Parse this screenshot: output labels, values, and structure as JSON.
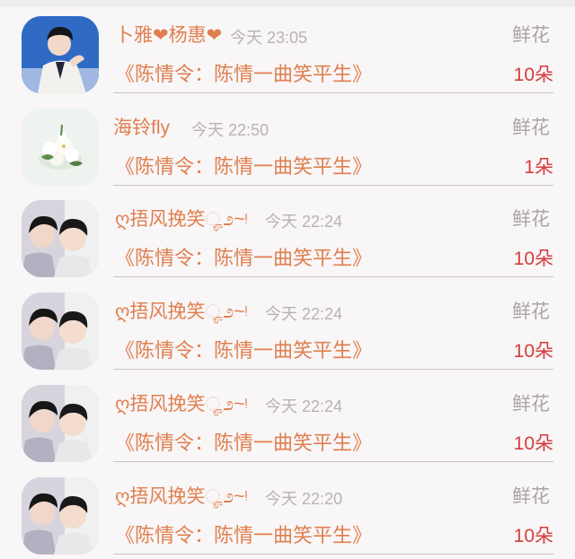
{
  "items": [
    {
      "name": "卜雅❤杨惠❤",
      "time": "今天 23:05",
      "gift": "鲜花",
      "title": "《陈情令：陈情一曲笑平生》",
      "count": "10朵",
      "avatar": "man-white-suit-photo"
    },
    {
      "name": "海铃fly",
      "time": "今天 22:50",
      "gift": "鲜花",
      "title": "《陈情令：陈情一曲笑平生》",
      "count": "1朵",
      "avatar": "white-flower-bouquet-photo"
    },
    {
      "name": "ღ捂风挽笑ೄ೨~ᵎ",
      "time": "今天 22:24",
      "gift": "鲜花",
      "title": "《陈情令：陈情一曲笑平生》",
      "count": "10朵",
      "avatar": "two-men-photo"
    },
    {
      "name": "ღ捂风挽笑ೄ೨~ᵎ",
      "time": "今天 22:24",
      "gift": "鲜花",
      "title": "《陈情令：陈情一曲笑平生》",
      "count": "10朵",
      "avatar": "two-men-photo"
    },
    {
      "name": "ღ捂风挽笑ೄ೨~ᵎ",
      "time": "今天 22:24",
      "gift": "鲜花",
      "title": "《陈情令：陈情一曲笑平生》",
      "count": "10朵",
      "avatar": "two-men-photo"
    },
    {
      "name": "ღ捂风挽笑ೄ೨~ᵎ",
      "time": "今天 22:20",
      "gift": "鲜花",
      "title": "《陈情令：陈情一曲笑平生》",
      "count": "10朵",
      "avatar": "two-men-photo"
    }
  ],
  "colors": {
    "name": "#e07f4f",
    "title": "#e07f4f",
    "count": "#d63b3b",
    "time": "#b7b2b4",
    "gift": "#a9a4a6",
    "divider": "#c9c4c6"
  }
}
